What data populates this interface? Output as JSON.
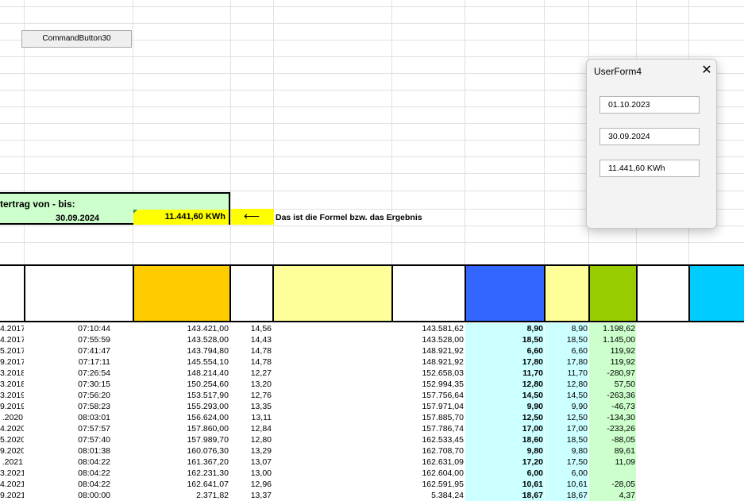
{
  "command_button": {
    "label": "CommandButton30"
  },
  "summary": {
    "title": "tertrag von - bis:",
    "date": "30.09.2024",
    "result": "11.441,60 KWh"
  },
  "note": {
    "arrow": "⟵",
    "text": "Das ist die Formel bzw. das Ergebnis"
  },
  "header_colors": {
    "orange": "#ffcc00",
    "light_yellow": "#ffff99",
    "blue": "#3366ff",
    "green": "#99cc00",
    "cyan": "#00ccff"
  },
  "rows": [
    [
      "4.2017",
      "07:10:44",
      "143.421,00",
      "14,56",
      "143.581,62",
      "8,90",
      "8,90",
      "1.198,62"
    ],
    [
      "4.2017",
      "07:55:59",
      "143.528,00",
      "14,43",
      "143.528,00",
      "18,50",
      "18,50",
      "1.145,00"
    ],
    [
      "5.2017",
      "07:41:47",
      "143.794,80",
      "14,78",
      "148.921,92",
      "6,60",
      "6,60",
      "119,92"
    ],
    [
      "9.2017",
      "07:17:11",
      "145.554,10",
      "14,78",
      "148.921,92",
      "17,80",
      "17,80",
      "119,92"
    ],
    [
      "3.2018",
      "07:26:54",
      "148.214,40",
      "12,27",
      "152.658,03",
      "11,70",
      "11,70",
      "-280,97"
    ],
    [
      "3.2018",
      "07:30:15",
      "150.254,60",
      "13,20",
      "152.994,35",
      "12,80",
      "12,80",
      "57,50"
    ],
    [
      "3.2019",
      "07:56:20",
      "153.517,90",
      "12,76",
      "157.756,64",
      "14,50",
      "14,50",
      "-263,36"
    ],
    [
      "9.2019",
      "07:58:23",
      "155.293,00",
      "13,35",
      "157.971,04",
      "9,90",
      "9,90",
      "-46,73"
    ],
    [
      ".2020",
      "08:03:01",
      "156.624,00",
      "13,11",
      "157.885,70",
      "12,50",
      "12,50",
      "-134,30"
    ],
    [
      "4.2020",
      "07:57:57",
      "157.860,00",
      "12,84",
      "157.786,74",
      "17,00",
      "17,00",
      "-233,26"
    ],
    [
      "5.2020",
      "07:57:40",
      "157.989,70",
      "12,80",
      "162.533,45",
      "18,60",
      "18,50",
      "-88,05"
    ],
    [
      "9.2020",
      "08:01:38",
      "160.076,30",
      "13,29",
      "162.708,70",
      "9,80",
      "9,80",
      "89,61"
    ],
    [
      ".2021",
      "08:04:22",
      "161.367,20",
      "13,07",
      "162.631,09",
      "17,20",
      "17,50",
      "11,09"
    ],
    [
      "3.2021",
      "08:04:22",
      "162.231,30",
      "13,00",
      "162.604,00",
      "6,00",
      "6,00",
      ""
    ],
    [
      "4.2021",
      "08:04:22",
      "162.641,07",
      "12,96",
      "162.591,95",
      "10,61",
      "10,61",
      "-28,05"
    ],
    [
      "9.2021",
      "08:00:00",
      "2.371,82",
      "13,37",
      "5.384,24",
      "18,67",
      "18,67",
      "4,37"
    ]
  ],
  "userform": {
    "title": "UserForm4",
    "close_glyph": "✕",
    "date_from": "01.10.2023",
    "date_to": "30.09.2024",
    "result": "11.441,60 KWh"
  }
}
